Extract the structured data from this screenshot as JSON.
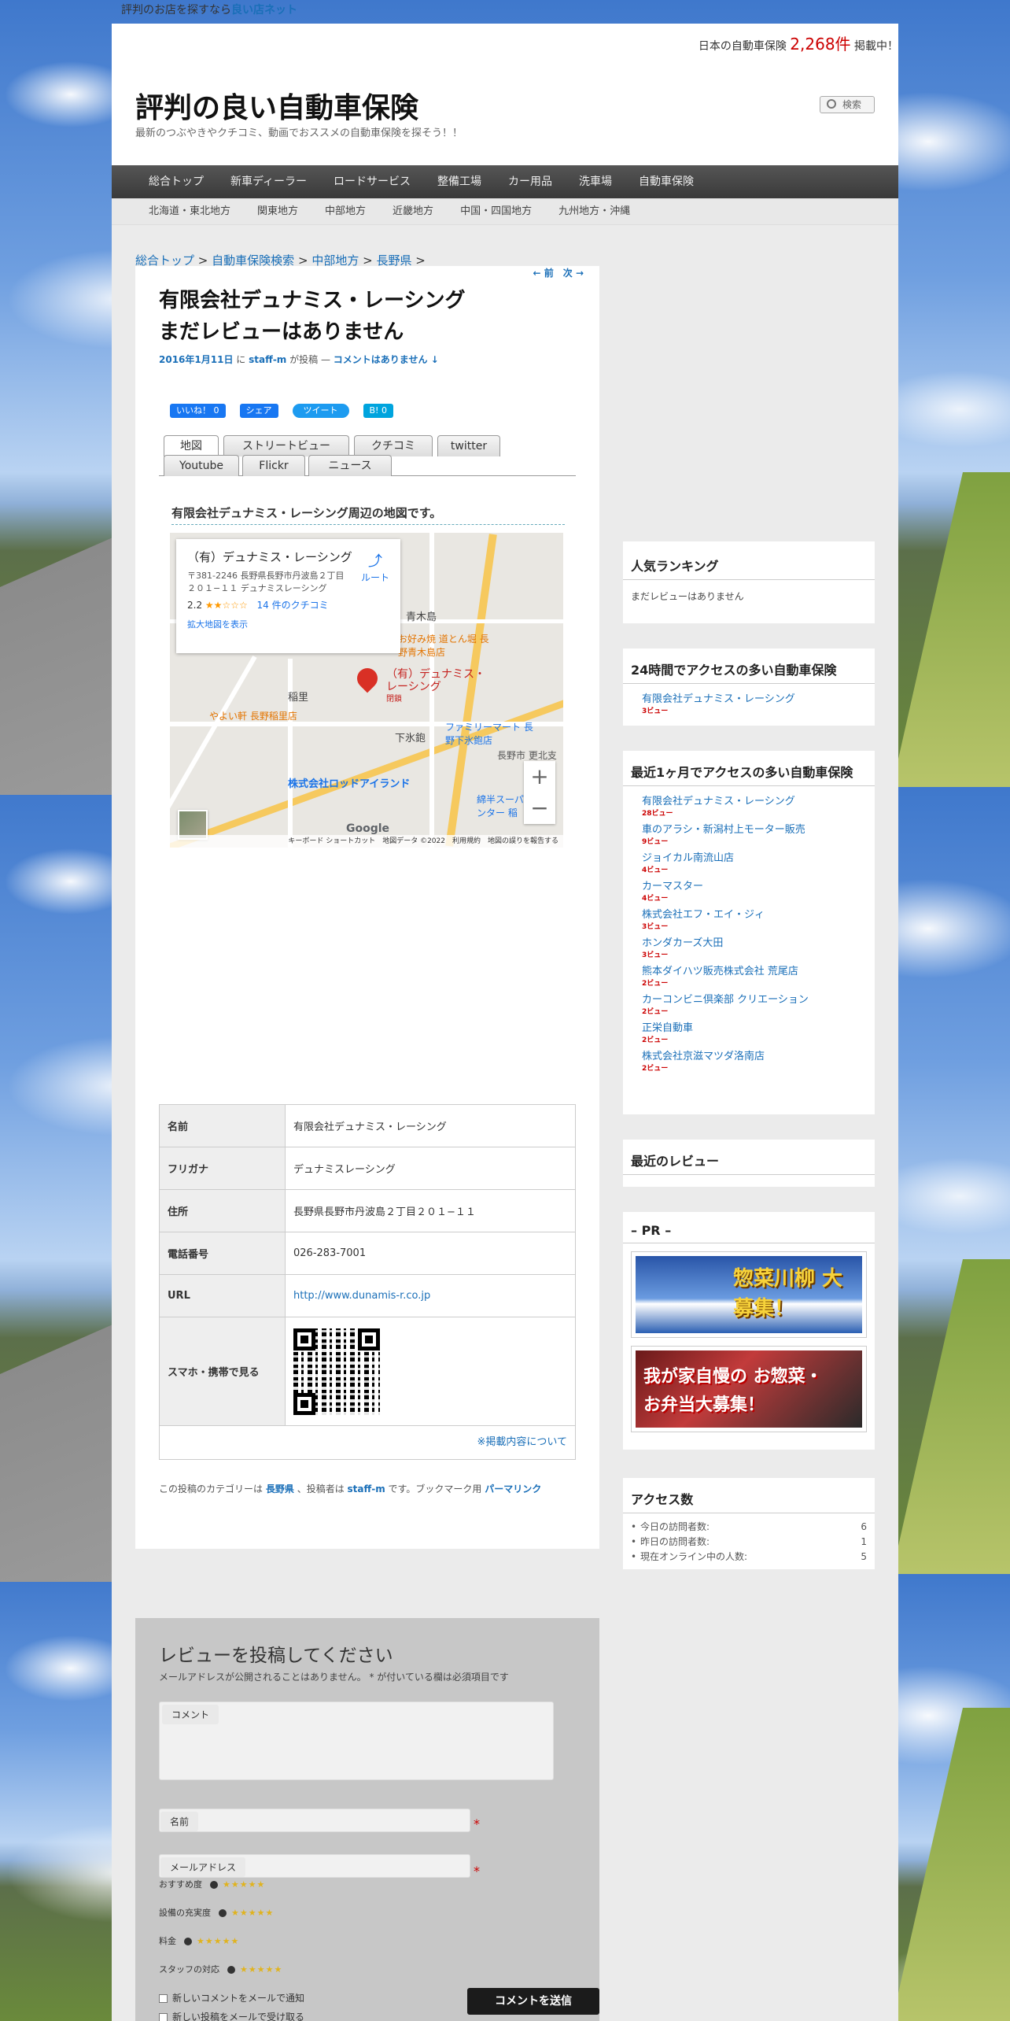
{
  "top": {
    "prefix": "評判のお店を探すなら",
    "brand": "良い店ネット"
  },
  "header": {
    "count_prefix": "日本の自動車保険",
    "count_value": "2,268件",
    "count_suffix": "掲載中！",
    "title": "評判の良い自動車保険",
    "description": "最新のつぶやきやクチコミ、動画でおススメの自動車保険を探そう！！",
    "search_placeholder": "検索"
  },
  "nav_main": [
    "総合トップ",
    "新車ディーラー",
    "ロードサービス",
    "整備工場",
    "カー用品",
    "洗車場",
    "自動車保険"
  ],
  "nav_sub": [
    "北海道・東北地方",
    "関東地方",
    "中部地方",
    "近畿地方",
    "中国・四国地方",
    "九州地方・沖縄"
  ],
  "breadcrumb": {
    "c1": "総合トップ",
    "c2": "自動車保険検索",
    "c3": "中部地方",
    "c4": "長野県",
    "sep": ">"
  },
  "post": {
    "nav": "← 前　次 →",
    "title_line1": "有限会社デュナミス・レーシング",
    "title_line2": "まだレビューはありません",
    "date": "2016年1月11日",
    "on": "に",
    "author": "staff-m",
    "by": "が投稿 —",
    "comments": "コメントはありません ↓",
    "share": {
      "like": "いいね！ 0",
      "share": "シェア",
      "tweet": "ツイート",
      "hatena": "B! 0"
    },
    "tabs": [
      "地図",
      "ストリートビュー",
      "クチコミ",
      "twitter",
      "Youtube",
      "Flickr",
      "ニュース"
    ],
    "map_title": "有限会社デュナミス・レーシング周辺の地図です。",
    "map": {
      "card_title": "（有）デュナミス・レーシング",
      "card_address": "〒381-2246 長野県長野市丹波島２丁目２０１−１１ デュナミスレーシング",
      "rating": "2.2",
      "stars": "★★☆☆☆",
      "reviews": "14 件のクチコミ",
      "enlarge": "拡大地図を表示",
      "route": "ルート",
      "pin_label": "（有）デュナミス・レーシング",
      "pin_status": "閉鎖",
      "pois": [
        "青木島",
        "稲里",
        "下氷鉋",
        "株式会社ロッドアイランド",
        "やよい軒 長野稲里店",
        "ファミリーマート 長野下氷鉋店",
        "お好み焼 道とん堀 長野青木島店",
        "長野市 更北支",
        "下氷鉋",
        "綿半スーパー センター 稲"
      ],
      "footer": "キーボード ショートカット　地図データ ©2022　利用規約　地図の誤りを報告する",
      "google": "Google"
    },
    "table": [
      {
        "k": "名前",
        "v": "有限会社デュナミス・レーシング"
      },
      {
        "k": "フリガナ",
        "v": "デュナミスレーシング"
      },
      {
        "k": "住所",
        "v": "長野県長野市丹波島２丁目２０１−１１"
      },
      {
        "k": "電話番号",
        "v": "026-283-7001"
      },
      {
        "k": "URL",
        "v": "http://www.dunamis-r.co.jp"
      },
      {
        "k": "スマホ・携帯で見る",
        "v": ""
      }
    ],
    "notice": "※掲載内容について",
    "cat_prefix": "この投稿のカテゴリーは",
    "cat": "長野県",
    "cat_mid": "、投稿者は",
    "cat_author": "staff-m",
    "cat_mid2": "です。ブックマーク用",
    "permalink": "パーマリンク"
  },
  "reply": {
    "title": "レビューを投稿してください",
    "note": "メールアドレスが公開されることはありません。 * が付いている欄は必須項目です",
    "comment_label": "コメント",
    "name_label": "名前",
    "email_label": "メールアドレス",
    "required": "*",
    "ratings": [
      "おすすめ度",
      "設備の充実度",
      "料金",
      "スタッフの対応"
    ],
    "stars": "★★★★★",
    "notify1": "新しいコメントをメールで通知",
    "notify2": "新しい投稿をメールで受け取る",
    "submit": "コメントを送信"
  },
  "sidebar": {
    "popular_title": "人気ランキング",
    "popular_empty": "まだレビューはありません",
    "day_title": "24時間でアクセスの多い自動車保険",
    "day_items": [
      {
        "name": "有限会社デュナミス・レーシング",
        "views": "3ビュー"
      }
    ],
    "month_title": "最近1ヶ月でアクセスの多い自動車保険",
    "month_items": [
      {
        "name": "有限会社デュナミス・レーシング",
        "views": "28ビュー"
      },
      {
        "name": "車のアラシ・新潟村上モーター販売",
        "views": "9ビュー"
      },
      {
        "name": "ジョイカル南流山店",
        "views": "4ビュー"
      },
      {
        "name": "カーマスター",
        "views": "4ビュー"
      },
      {
        "name": "株式会社エフ・エイ・ジィ",
        "views": "3ビュー"
      },
      {
        "name": "ホンダカーズ大田",
        "views": "3ビュー"
      },
      {
        "name": "熊本ダイハツ販売株式会社 荒尾店",
        "views": "2ビュー"
      },
      {
        "name": "カーコンビニ倶楽部 クリエーション",
        "views": "2ビュー"
      },
      {
        "name": "正栄自動車",
        "views": "2ビュー"
      },
      {
        "name": "株式会社京滋マツダ洛南店",
        "views": "2ビュー"
      }
    ],
    "recent_title": "最近のレビュー",
    "pr_title": "– PR –",
    "banner1": "惣菜川柳 大募集！",
    "banner2": "我が家自慢の お惣菜・お弁当大募集！",
    "access_title": "アクセス数",
    "access": [
      {
        "k": "今日の訪問者数:",
        "v": "6"
      },
      {
        "k": "昨日の訪問者数:",
        "v": "1"
      },
      {
        "k": "現在オンライン中の人数:",
        "v": "5"
      }
    ]
  }
}
